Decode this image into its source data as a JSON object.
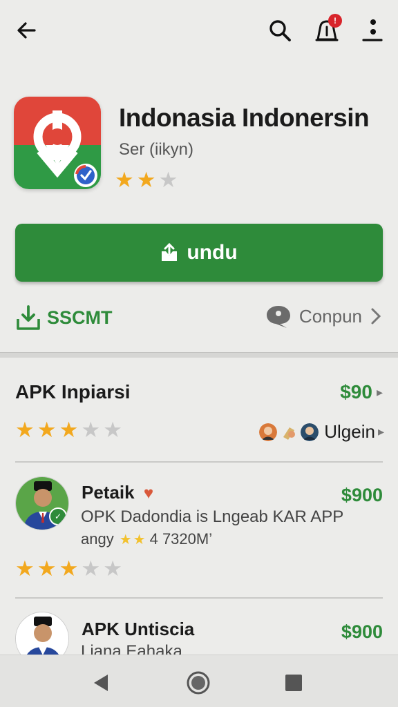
{
  "topbar": {
    "back_icon": "arrow-left-icon",
    "search_icon": "search-icon",
    "notification_icon": "bell-icon",
    "notification_badge": "!",
    "more_icon": "more-vertical-icon"
  },
  "app": {
    "title": "Indonasia Indonersin",
    "subtitle": "Ser (iikyn)",
    "rating": 2,
    "rating_max": 3
  },
  "install_button": {
    "label": "undu",
    "icon": "download-icon"
  },
  "actions": {
    "save_label": "SSCMT",
    "save_icon": "download-tray-icon",
    "compare_label": "Conpun",
    "compare_icon": "chat-bubble-icon"
  },
  "section": {
    "title": "APK Inpiarsi",
    "price": "$90",
    "rating": 3,
    "rating_max": 5,
    "users_label": "Ulgein"
  },
  "items": [
    {
      "title": "Petaik",
      "price": "$900",
      "description": "OPK Dadondia is Lngeab KAR APP",
      "meta_prefix": "angy",
      "meta_value": "4 7320M’",
      "rating": 3,
      "rating_max": 5
    },
    {
      "title": "APK Untiscia",
      "price": "$900",
      "description": "Liana Eahaka"
    }
  ],
  "navbar": {
    "back": "triangle-back-icon",
    "home": "circle-home-icon",
    "recents": "square-recents-icon"
  },
  "colors": {
    "accent": "#2e8b3a",
    "star": "#f2a81e",
    "badge": "#d8242b",
    "background": "#ececea"
  }
}
